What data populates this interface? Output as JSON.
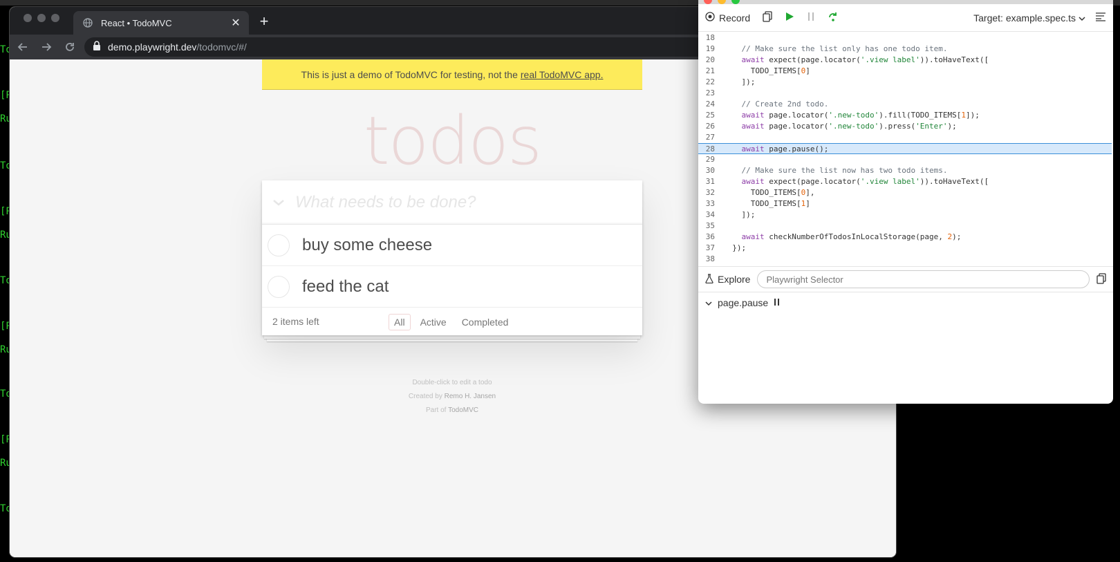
{
  "terminal": {
    "lines": [
      "To",
      "[P",
      "Ru",
      "To",
      "[P",
      "Ru",
      "To",
      "[P",
      "Ru",
      "To",
      "[P",
      "Ru",
      "To"
    ]
  },
  "browser": {
    "tab_title": "React • TodoMVC",
    "url_host": "demo.playwright.dev",
    "url_path": "/todomvc/#/",
    "icons": [
      "globe-icon",
      "close-icon",
      "plus-icon",
      "back-icon",
      "forward-icon",
      "reload-icon",
      "lock-icon"
    ]
  },
  "todomvc": {
    "banner_text": "This is just a demo of TodoMVC for testing, not the",
    "banner_link": "real TodoMVC app.",
    "title": "todos",
    "new_todo_placeholder": "What needs to be done?",
    "items": [
      {
        "label": "buy some cheese",
        "completed": false
      },
      {
        "label": "feed the cat",
        "completed": false
      }
    ],
    "items_left": "2 items left",
    "filters": [
      "All",
      "Active",
      "Completed"
    ],
    "selected_filter": "All",
    "info": {
      "edit_hint": "Double-click to edit a todo",
      "created_by_prefix": "Created by",
      "author": "Remo H. Jansen",
      "part_of_prefix": "Part of",
      "part_of_link": "TodoMVC"
    },
    "accent": "#af2f2f",
    "banner_color": "#fdeb5b"
  },
  "inspector": {
    "record_label": "Record",
    "target_label": "Target:",
    "target_value": "example.spec.ts",
    "code": [
      {
        "n": "18",
        "text": ""
      },
      {
        "n": "19",
        "text": "    // Make sure the list only has one todo item."
      },
      {
        "n": "20",
        "text": "    await expect(page.locator('.view label')).toHaveText(["
      },
      {
        "n": "21",
        "text": "      TODO_ITEMS[0]"
      },
      {
        "n": "22",
        "text": "    ]);"
      },
      {
        "n": "23",
        "text": ""
      },
      {
        "n": "24",
        "text": "    // Create 2nd todo."
      },
      {
        "n": "25",
        "text": "    await page.locator('.new-todo').fill(TODO_ITEMS[1]);"
      },
      {
        "n": "26",
        "text": "    await page.locator('.new-todo').press('Enter');"
      },
      {
        "n": "27",
        "text": ""
      },
      {
        "n": "28",
        "text": "    await page.pause();"
      },
      {
        "n": "29",
        "text": ""
      },
      {
        "n": "30",
        "text": "    // Make sure the list now has two todo items."
      },
      {
        "n": "31",
        "text": "    await expect(page.locator('.view label')).toHaveText(["
      },
      {
        "n": "32",
        "text": "      TODO_ITEMS[0],"
      },
      {
        "n": "33",
        "text": "      TODO_ITEMS[1]"
      },
      {
        "n": "34",
        "text": "    ]);"
      },
      {
        "n": "35",
        "text": ""
      },
      {
        "n": "36",
        "text": "    await checkNumberOfTodosInLocalStorage(page, 2);"
      },
      {
        "n": "37",
        "text": "  });"
      },
      {
        "n": "38",
        "text": ""
      }
    ],
    "highlighted_line": "28",
    "explore_label": "Explore",
    "selector_placeholder": "Playwright Selector",
    "call_log_entry": "page.pause",
    "colors": {
      "play": "#1fa831",
      "highlight": "#d7e9fb"
    }
  }
}
